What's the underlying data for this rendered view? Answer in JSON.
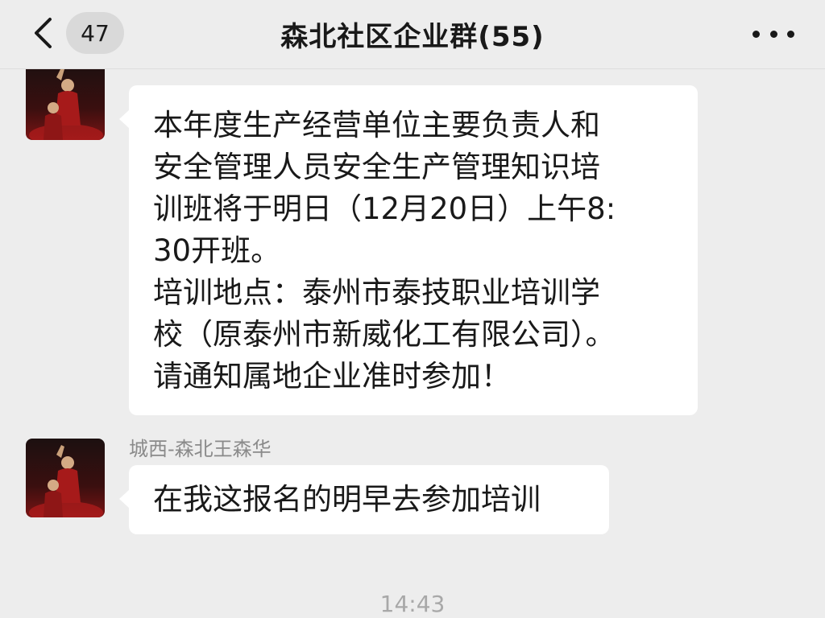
{
  "header": {
    "back_icon": "chevron-left-icon",
    "unread_count": "47",
    "title": "森北社区企业群(55)",
    "more_icon": "ellipsis-icon"
  },
  "messages": [
    {
      "sender": "城西-森北王森华",
      "avatar_icon": "user-avatar-photo",
      "text": "本年度生产经营单位主要负责人和\n安全管理人员安全生产管理知识培\n训班将于明日（12月20日）上午8:\n30开班。\n培训地点：泰州市泰技职业培训学\n校（原泰州市新威化工有限公司）。\n请通知属地企业准时参加！"
    },
    {
      "sender": "城西-森北王森华",
      "avatar_icon": "user-avatar-photo",
      "text": "在我这报名的明早去参加培训"
    }
  ],
  "timestamp": "14:43",
  "colors": {
    "background": "#ededed",
    "bubble": "#ffffff",
    "secondary_text": "#8a8a8a"
  }
}
